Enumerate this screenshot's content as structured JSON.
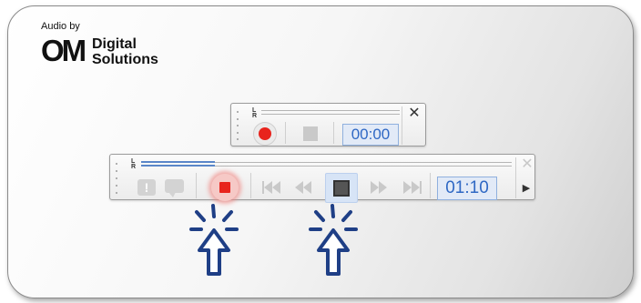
{
  "logo": {
    "audio_by": "Audio by",
    "om": "OM",
    "line1": "Digital",
    "line2": "Solutions"
  },
  "small_toolbar": {
    "meter_label": "L R",
    "time": "00:00",
    "close_glyph": "✕"
  },
  "large_toolbar": {
    "meter_label": "L R",
    "meter_level_fraction": 0.2,
    "time": "01:10",
    "close_glyph": "✕",
    "expand_glyph": "▶",
    "buttons": [
      "index-mark",
      "comment",
      "record",
      "skip-to-start",
      "rewind",
      "stop",
      "fast-forward",
      "skip-to-end"
    ],
    "highlighted": [
      "record",
      "stop"
    ]
  },
  "colors": {
    "record_red": "#e8231c",
    "time_text": "#2f68c4",
    "cursor_blue": "#1f3f86",
    "meter_blue": "#5a86c8"
  },
  "annotations": [
    "click-cursor-icon",
    "click-cursor-icon"
  ]
}
